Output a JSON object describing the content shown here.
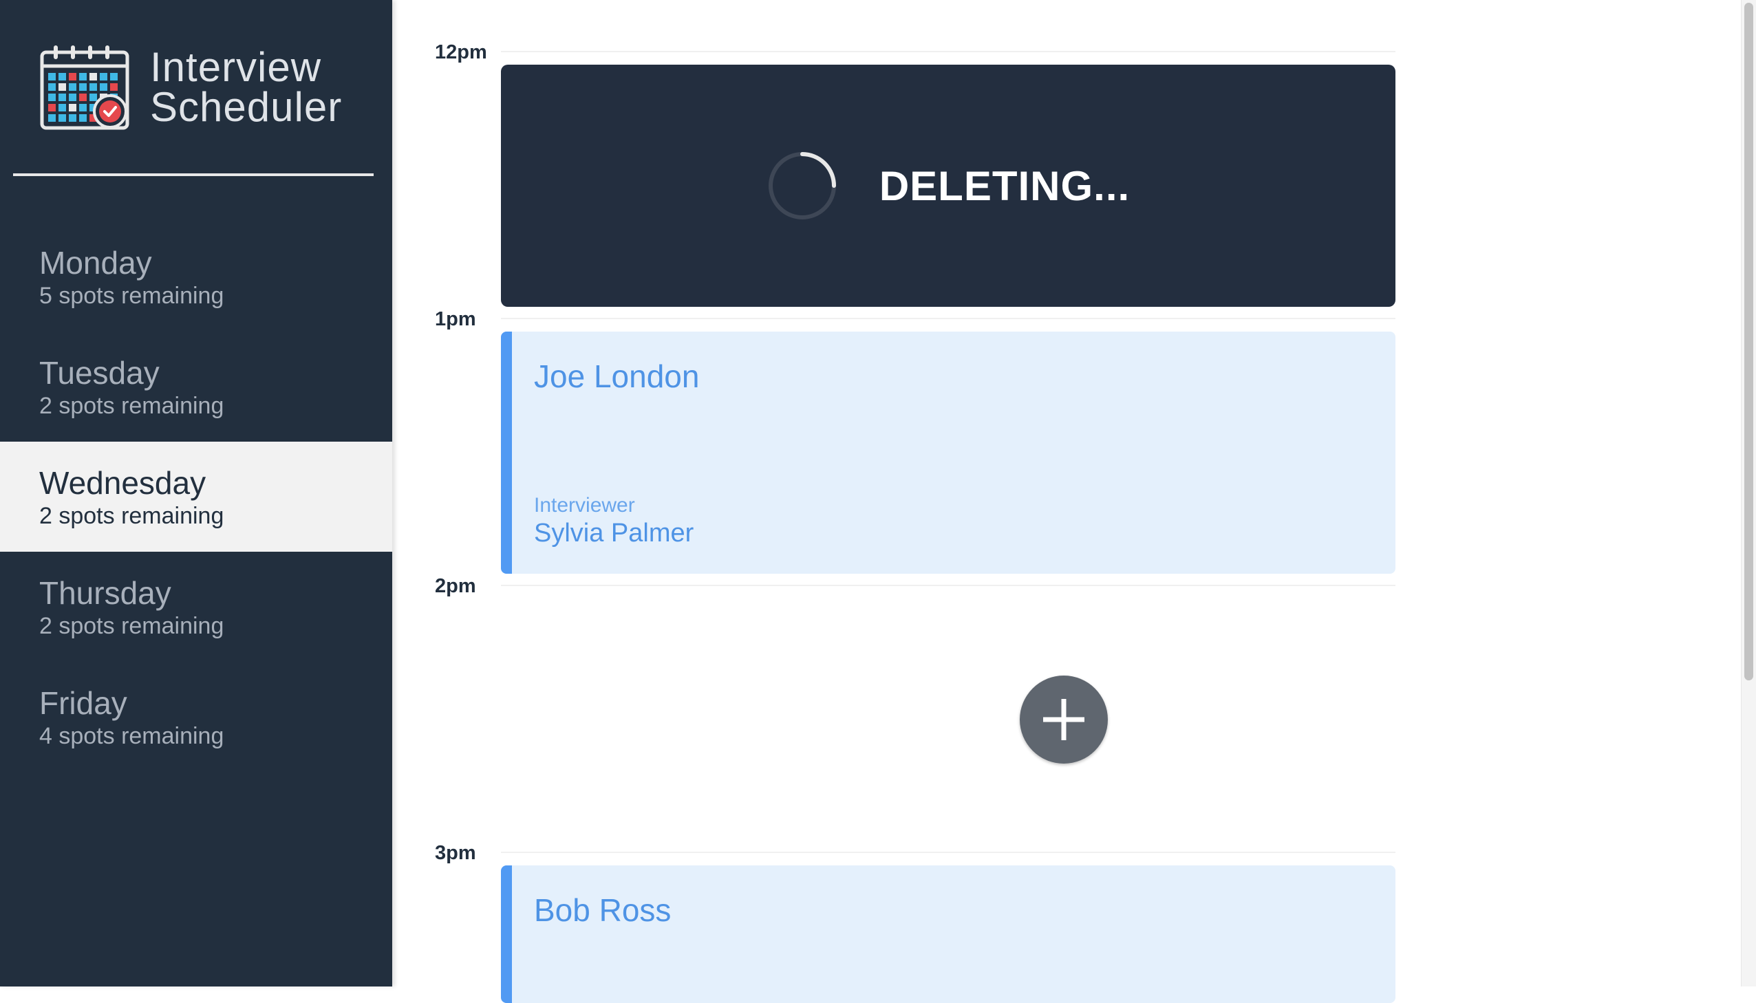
{
  "app": {
    "title_line1": "Interview",
    "title_line2": "Scheduler"
  },
  "days": [
    {
      "name": "Monday",
      "spots": "5 spots remaining",
      "selected": false
    },
    {
      "name": "Tuesday",
      "spots": "2 spots remaining",
      "selected": false
    },
    {
      "name": "Wednesday",
      "spots": "2 spots remaining",
      "selected": true
    },
    {
      "name": "Thursday",
      "spots": "2 spots remaining",
      "selected": false
    },
    {
      "name": "Friday",
      "spots": "4 spots remaining",
      "selected": false
    }
  ],
  "schedule": {
    "times": [
      "12pm",
      "1pm",
      "2pm",
      "3pm"
    ],
    "deleting_status": "DELETING...",
    "appointments": [
      {
        "student": "Joe London",
        "interviewer_label": "Interviewer",
        "interviewer": "Sylvia Palmer"
      },
      {
        "student": "Bob Ross"
      }
    ],
    "add_icon": "plus-icon",
    "spinner_icon": "loading-spinner-icon"
  },
  "colors": {
    "sidebar_bg": "#222f3e",
    "selected_day_bg": "#f2f2f2",
    "appointment_bg": "#e4f0fc",
    "appointment_accent": "#519af3",
    "deleting_bg": "#232e3f",
    "add_button": "#5f666f"
  }
}
